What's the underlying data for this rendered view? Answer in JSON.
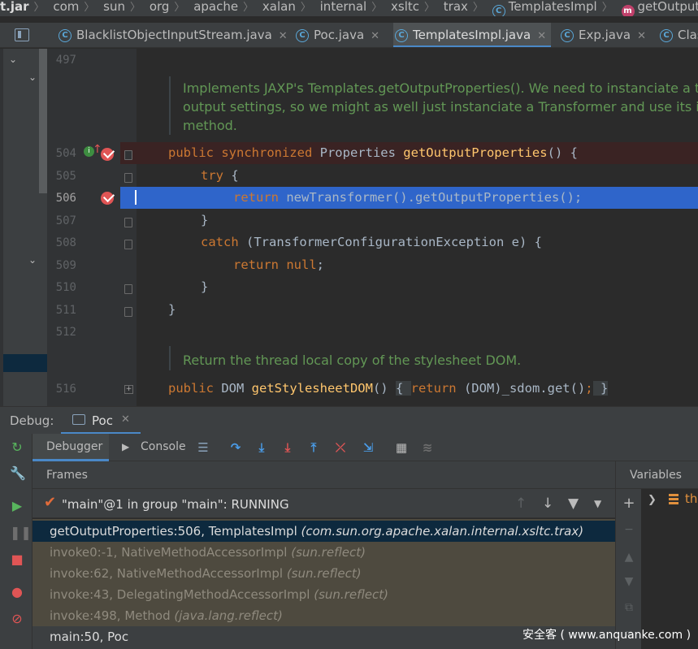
{
  "breadcrumb": {
    "items": [
      "t.jar",
      "com",
      "sun",
      "org",
      "apache",
      "xalan",
      "internal",
      "xsltc",
      "trax",
      "TemplatesImpl",
      "getOutputProperties"
    ]
  },
  "tabs": [
    {
      "label": "BlacklistObjectInputStream.java",
      "icon": "c",
      "active": false
    },
    {
      "label": "Poc.java",
      "icon": "c",
      "active": false
    },
    {
      "label": "TemplatesImpl.java",
      "icon": "c",
      "active": true
    },
    {
      "label": "Exp.java",
      "icon": "c",
      "active": false
    },
    {
      "label": "Clas",
      "icon": "c",
      "active": false
    }
  ],
  "editor": {
    "line_numbers": [
      "497",
      "504",
      "505",
      "506",
      "507",
      "508",
      "509",
      "510",
      "511",
      "512",
      "516"
    ],
    "doc1": [
      "Implements JAXP's Templates.getOutputProperties(). We need to instanciate a trans",
      "output settings, so we might as well just instanciate a Transformer and use its imple",
      "method."
    ],
    "doc2": "Return the thread local copy of the stylesheet DOM.",
    "lines": {
      "l504": {
        "kw": "public synchronized ",
        "type": "Properties ",
        "fn": "getOutputProperties",
        "rest": "() {"
      },
      "l505": {
        "kw": "try",
        "rest": " {"
      },
      "l506": {
        "kw": "return ",
        "rest": "newTransformer().getOutputProperties();"
      },
      "l507": {
        "rest": "}"
      },
      "l508": {
        "kw": "catch",
        "rest": " (TransformerConfigurationException e) {"
      },
      "l509": {
        "kw": "return null",
        "rest": ";"
      },
      "l510": {
        "rest": "}"
      },
      "l511": {
        "rest": "}"
      },
      "l516": {
        "kw": "public ",
        "type": "DOM ",
        "fn": "getStylesheetDOM",
        "rest1": "() ",
        "brace1": "{ ",
        "kw2": "return ",
        "rest2": "(DOM)_sdom.get()",
        "semi": ";",
        "brace2": " }"
      }
    },
    "colors": {
      "keyword": "#cc7832",
      "method": "#ffc66d",
      "doc": "#629755",
      "text": "#a9b7c6",
      "current_line": "#2f65ca",
      "breakpoint_line": "#3a2323"
    }
  },
  "debug": {
    "label": "Debug:",
    "session_tab": "Poc",
    "tabs": [
      "Debugger",
      "Console"
    ],
    "frames_header": "Frames",
    "variables_header": "Variables",
    "thread": "\"main\"@1 in group \"main\": RUNNING",
    "frames": [
      {
        "method": "getOutputProperties:506, TemplatesImpl",
        "pkg": "(com.sun.org.apache.xalan.internal.xsltc.trax)"
      },
      {
        "method": "invoke0:-1, NativeMethodAccessorImpl",
        "pkg": "(sun.reflect)"
      },
      {
        "method": "invoke:62, NativeMethodAccessorImpl",
        "pkg": "(sun.reflect)"
      },
      {
        "method": "invoke:43, DelegatingMethodAccessorImpl",
        "pkg": "(sun.reflect)"
      },
      {
        "method": "invoke:498, Method",
        "pkg": "(java.lang.reflect)"
      },
      {
        "method": "main:50, Poc",
        "pkg": ""
      }
    ],
    "variable_first": "th"
  },
  "watermark": "安全客 ( www.anquanke.com )"
}
